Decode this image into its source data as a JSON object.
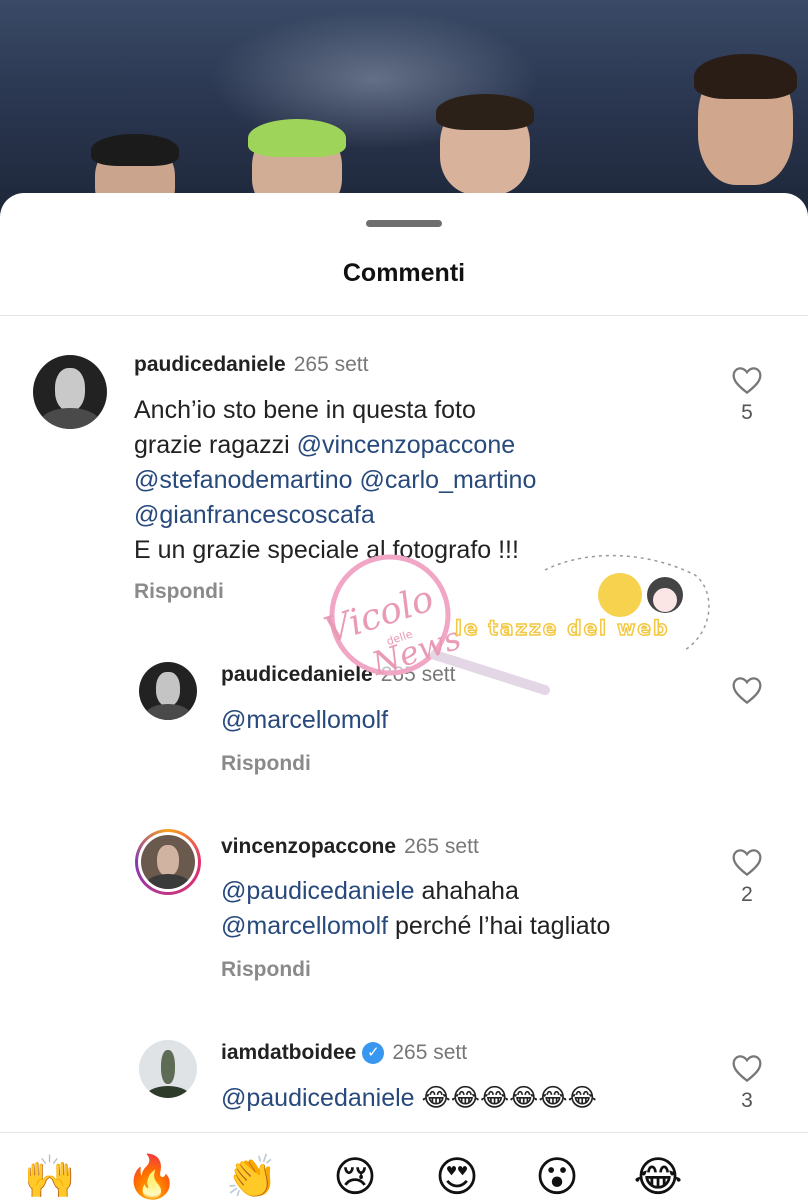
{
  "sheet": {
    "title": "Commenti"
  },
  "comments": [
    {
      "username": "paudicedaniele",
      "time": "265 sett",
      "lines": [
        [
          {
            "t": "Anch’io sto bene in questa foto"
          }
        ],
        [
          {
            "t": "grazie ragazzi "
          },
          {
            "t": "@vincenzopaccone",
            "m": true
          }
        ],
        [
          {
            "t": "@stefanodemartino",
            "m": true
          },
          {
            "t": " "
          },
          {
            "t": "@carlo_martino",
            "m": true
          }
        ],
        [
          {
            "t": "@gianfrancescoscafa",
            "m": true
          }
        ],
        [
          {
            "t": "E un grazie speciale al fotografo !!!"
          }
        ]
      ],
      "reply_label": "Rispondi",
      "likes": "5"
    },
    {
      "username": "paudicedaniele",
      "time": "265 sett",
      "lines": [
        [
          {
            "t": "@marcellomolf",
            "m": true
          }
        ]
      ],
      "reply_label": "Rispondi",
      "likes": ""
    },
    {
      "username": "vincenzopaccone",
      "time": "265 sett",
      "lines": [
        [
          {
            "t": "@paudicedaniele",
            "m": true
          },
          {
            "t": " ahahaha"
          }
        ],
        [
          {
            "t": "@marcellomolf",
            "m": true
          },
          {
            "t": " perché l’hai tagliato"
          }
        ]
      ],
      "reply_label": "Rispondi",
      "likes": "2"
    },
    {
      "username": "iamdatboidee",
      "verified": true,
      "time": "265 sett",
      "lines": [
        [
          {
            "t": "@paudicedaniele",
            "m": true
          },
          {
            "t": " 😂😂😂😂😂😂"
          }
        ]
      ],
      "likes": "3"
    }
  ],
  "watermark": {
    "text1": "Vicolo",
    "text2": "delle",
    "text3": "News",
    "text4": "le tazze del web"
  },
  "emoji_bar": [
    "🙌",
    "🔥",
    "👏",
    "😢",
    "😍",
    "😮",
    "😂"
  ],
  "icons": {
    "like": "heart-outline-icon",
    "verified": "verified-badge-icon"
  },
  "colors": {
    "mention": "#27497c",
    "muted": "#8a8a8a",
    "verified": "#3897f0"
  }
}
